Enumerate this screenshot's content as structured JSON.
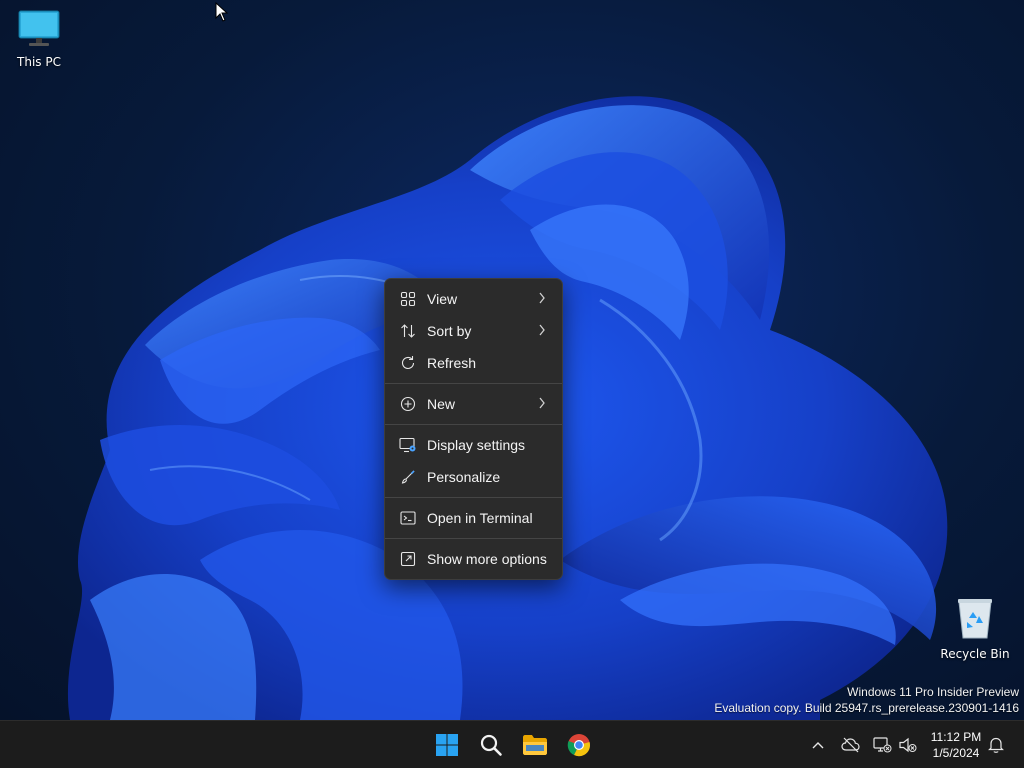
{
  "desktop": {
    "icons": [
      {
        "label": "This PC"
      },
      {
        "label": "Recycle Bin"
      }
    ],
    "watermark": {
      "line1": "Windows 11 Pro Insider Preview",
      "line2": "Evaluation copy. Build 25947.rs_prerelease.230901-1416"
    }
  },
  "context_menu": {
    "items": [
      {
        "label": "View",
        "icon": "grid-icon",
        "submenu": true
      },
      {
        "label": "Sort by",
        "icon": "sort-icon",
        "submenu": true
      },
      {
        "label": "Refresh",
        "icon": "refresh-icon",
        "submenu": false
      },
      {
        "label": "New",
        "icon": "plus-circle-icon",
        "submenu": true
      },
      {
        "label": "Display settings",
        "icon": "display-settings-icon",
        "submenu": false
      },
      {
        "label": "Personalize",
        "icon": "brush-icon",
        "submenu": false
      },
      {
        "label": "Open in Terminal",
        "icon": "terminal-icon",
        "submenu": false
      },
      {
        "label": "Show more options",
        "icon": "more-options-icon",
        "submenu": false
      }
    ]
  },
  "taskbar": {
    "apps": [
      {
        "name": "start",
        "icon": "windows-start-icon"
      },
      {
        "name": "search",
        "icon": "search-icon"
      },
      {
        "name": "file-explorer",
        "icon": "folder-icon"
      },
      {
        "name": "chrome",
        "icon": "chrome-icon"
      }
    ],
    "tray": {
      "time": "11:12 PM",
      "date": "1/5/2024"
    }
  },
  "colors": {
    "menu_bg": "#2b2b2b",
    "taskbar_bg": "#1c1c1c",
    "accent_blue": "#2f6ff5",
    "start_blue": "#29a3f2"
  }
}
